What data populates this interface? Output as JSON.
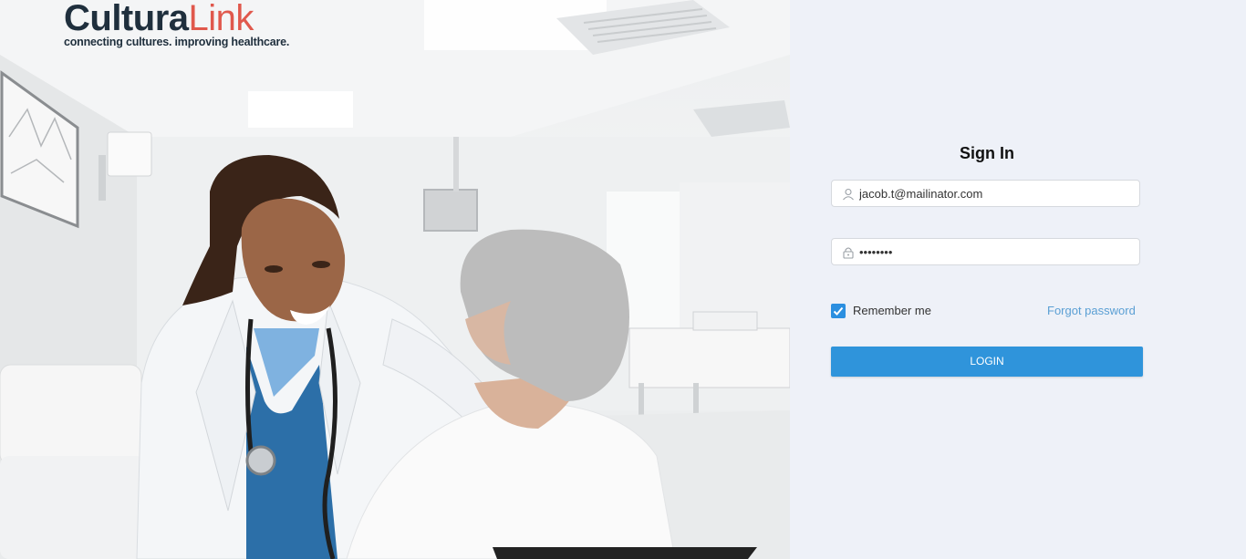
{
  "brand": {
    "name_main": "Cultura",
    "name_accent": "Link",
    "tagline": "connecting cultures. improving healthcare."
  },
  "hero": {
    "icon": "hero-photo"
  },
  "signin": {
    "title": "Sign In",
    "email_value": "jacob.t@mailinator.com",
    "password_value": "••••••••",
    "remember_label": "Remember me",
    "remember_checked": true,
    "forgot_label": "Forgot password",
    "login_label": "LOGIN"
  },
  "colors": {
    "panel_bg": "#eef1f8",
    "accent": "#2f94db",
    "link": "#5a9fd4",
    "logo_dark": "#1f2f3d",
    "logo_accent": "#e0584c"
  }
}
